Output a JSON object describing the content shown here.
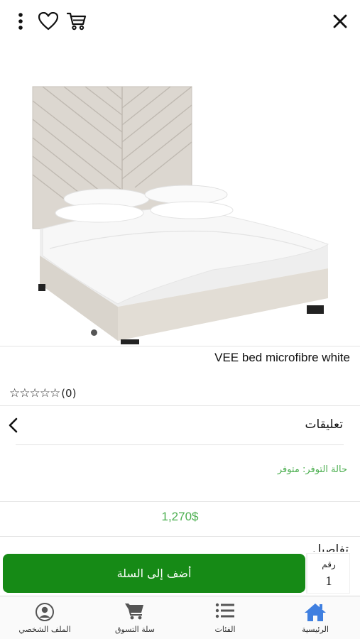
{
  "header": {
    "more_icon": "more-vertical-icon",
    "favorite_icon": "heart-icon",
    "cart_icon": "cart-icon",
    "close_icon": "close-icon"
  },
  "product": {
    "image_description_icon": "bed-product-image",
    "title": "VEE bed microfibre white",
    "rating_stars": "☆☆☆☆☆",
    "rating_count": "(0)",
    "comments_label": "تعليقات",
    "availability": "حالة التوفر: متوفر",
    "price": "1,270$",
    "details_peek": "تفاصيل"
  },
  "cart_action": {
    "add_label": "أضف إلى السلة",
    "qty_label": "رقم",
    "qty_value": "1"
  },
  "bottom_nav": {
    "home": "الرئيسية",
    "categories": "الفئات",
    "cart": "سلة التسوق",
    "profile": "الملف الشخصي"
  },
  "colors": {
    "accent_green": "#168a16",
    "price_green": "#4caf50",
    "home_blue": "#3f7fe0"
  }
}
